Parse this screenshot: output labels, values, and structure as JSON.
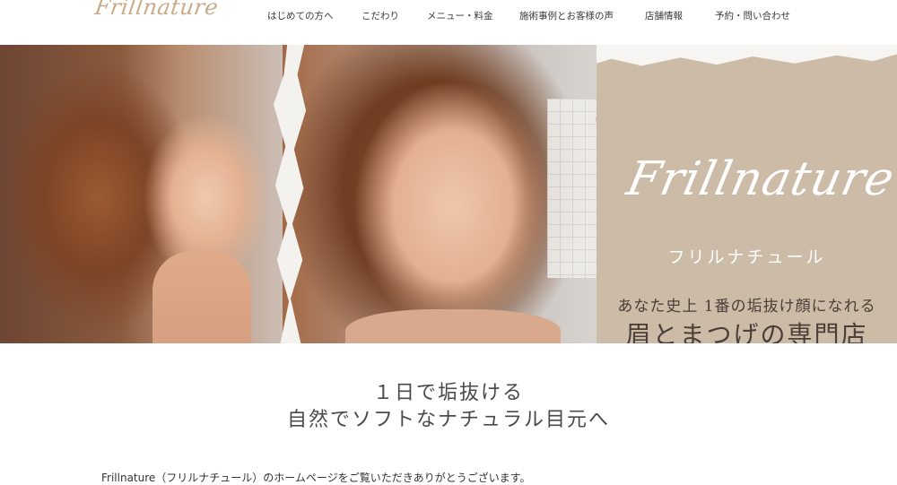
{
  "header": {
    "logo": "Frillnature",
    "nav": [
      "はじめての方へ",
      "こだわり",
      "メニュー・料金",
      "施術事例とお客様の声",
      "店舗情報",
      "予約・問い合わせ"
    ]
  },
  "hero": {
    "brand_script": "Frillnature",
    "brand_kana": "フリルナチュール",
    "tagline_small": "あなた史上 1番の垢抜け顔になれる",
    "tagline_big": "眉とまつげの専門店"
  },
  "main": {
    "headline_line1": "１日で垢抜ける",
    "headline_line2": "自然でソフトなナチュラル目元へ",
    "intro": "Frillnature（フリルナチュール）のホームページをご覧いただきありがとうございます。"
  }
}
